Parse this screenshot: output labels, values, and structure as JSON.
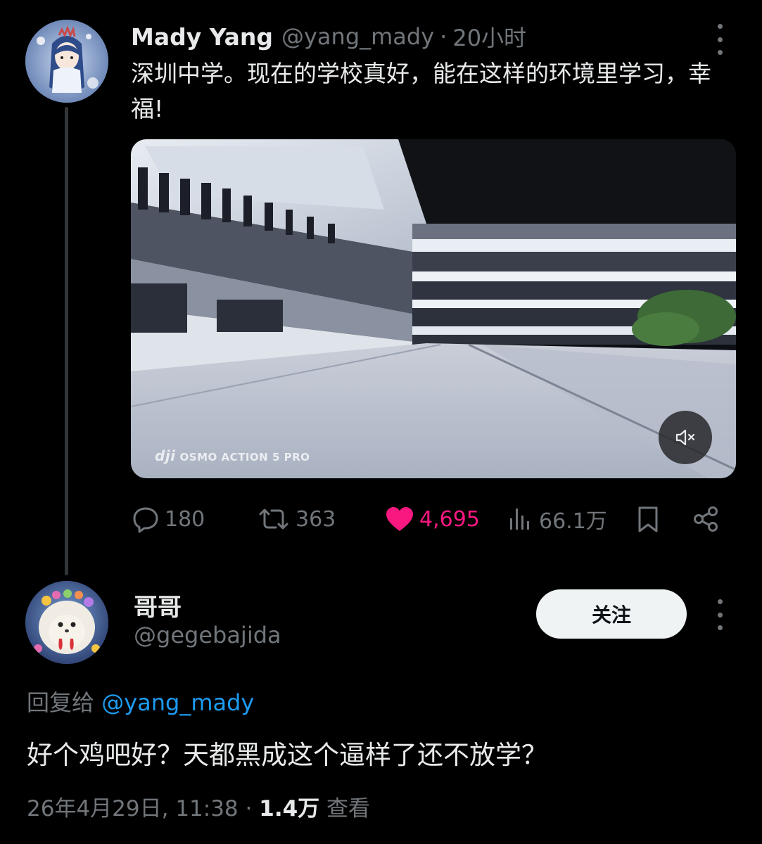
{
  "tweet": {
    "display_name": "Mady Yang",
    "handle": "@yang_mady",
    "separator": "·",
    "time": "20小时",
    "text": "深圳中学。现在的学校真好，能在这样的环境里学习，幸福!",
    "media": {
      "watermark_brand": "dji",
      "watermark_text": "OSMO ACTION 5 PRO",
      "mute_icon": "volume-muted-icon"
    },
    "actions": {
      "replies": "180",
      "reposts": "363",
      "likes": "4,695",
      "views": "66.1万",
      "like_color": "#f91880"
    }
  },
  "reply": {
    "display_name": "哥哥",
    "handle": "@gegebajida",
    "follow_label": "关注",
    "reply_to_prefix": "回复给",
    "reply_to_mention": "@yang_mady",
    "text": "好个鸡吧好？天都黑成这个逼样了还不放学？",
    "date": "26年4月29日, 11:38",
    "meta_separator": "·",
    "views_count": "1.4万",
    "views_label": "查看"
  },
  "colors": {
    "background": "#000000",
    "text_primary": "#e7e9ea",
    "text_secondary": "#71767b",
    "link": "#1d9bf0",
    "like": "#f91880"
  }
}
